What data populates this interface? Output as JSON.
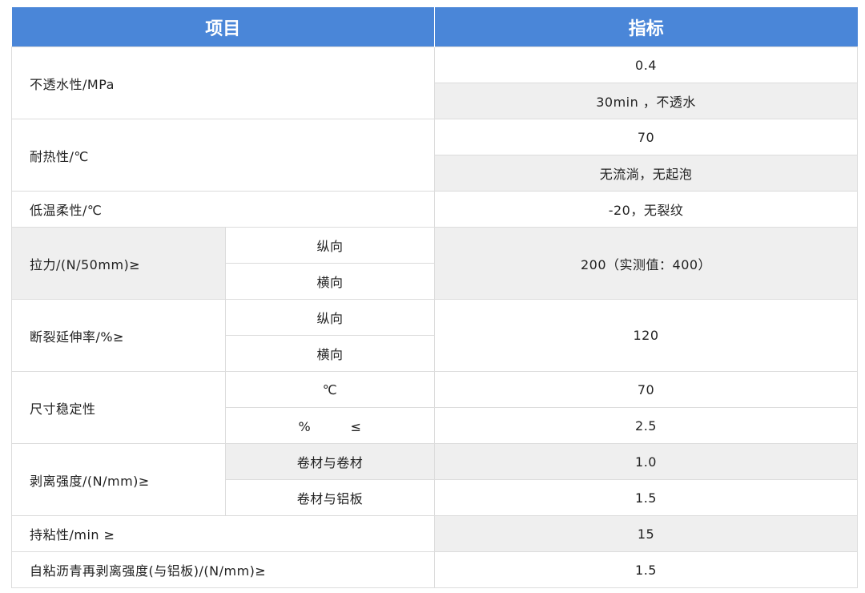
{
  "header": {
    "col_item": "项目",
    "col_spec": "指标"
  },
  "rows": {
    "waterproof": {
      "label": "不透水性/MPa",
      "v1": "0.4",
      "v2": "30min ，不透水"
    },
    "heat": {
      "label": "耐热性/℃",
      "v1": "70",
      "v2": "无流淌，无起泡"
    },
    "lowtemp": {
      "label": "低温柔性/℃",
      "v1": "-20，无裂纹"
    },
    "tensile": {
      "label": "拉力/(N/50mm)≥",
      "sub1": "纵向",
      "sub2": "横向",
      "value": "200（实测值：400）"
    },
    "elongation": {
      "label": "断裂延伸率/%≥",
      "sub1": "纵向",
      "sub2": "横向",
      "value": "120"
    },
    "dimension": {
      "label": "尺寸稳定性",
      "sub1": "℃",
      "sub2": "%　　　≤",
      "v1": "70",
      "v2": "2.5"
    },
    "peel": {
      "label": "剥离强度/(N/mm)≥",
      "sub1": "卷材与卷材",
      "sub2": "卷材与铝板",
      "v1": "1.0",
      "v2": "1.5"
    },
    "tack": {
      "label": "持粘性/min ≥",
      "value": "15"
    },
    "repeel": {
      "label": "自粘沥青再剥离强度(与铝板)/(N/mm)≥",
      "value": "1.5"
    }
  }
}
